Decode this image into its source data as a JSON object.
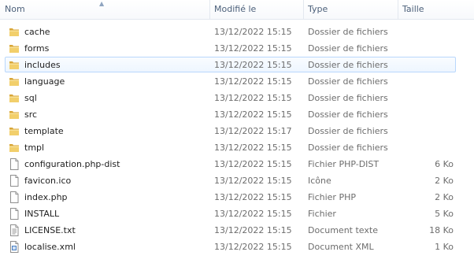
{
  "columns": {
    "name": "Nom",
    "modified": "Modifié le",
    "type": "Type",
    "size": "Taille"
  },
  "files": [
    {
      "name": "cache",
      "date": "13/12/2022 15:15",
      "type": "Dossier de fichiers",
      "size": "",
      "icon": "folder-icon"
    },
    {
      "name": "forms",
      "date": "13/12/2022 15:15",
      "type": "Dossier de fichiers",
      "size": "",
      "icon": "folder-icon"
    },
    {
      "name": "includes",
      "date": "13/12/2022 15:15",
      "type": "Dossier de fichiers",
      "size": "",
      "icon": "folder-icon"
    },
    {
      "name": "language",
      "date": "13/12/2022 15:15",
      "type": "Dossier de fichiers",
      "size": "",
      "icon": "folder-icon"
    },
    {
      "name": "sql",
      "date": "13/12/2022 15:15",
      "type": "Dossier de fichiers",
      "size": "",
      "icon": "folder-icon"
    },
    {
      "name": "src",
      "date": "13/12/2022 15:15",
      "type": "Dossier de fichiers",
      "size": "",
      "icon": "folder-icon"
    },
    {
      "name": "template",
      "date": "13/12/2022 15:17",
      "type": "Dossier de fichiers",
      "size": "",
      "icon": "folder-icon"
    },
    {
      "name": "tmpl",
      "date": "13/12/2022 15:15",
      "type": "Dossier de fichiers",
      "size": "",
      "icon": "folder-icon"
    },
    {
      "name": "configuration.php-dist",
      "date": "13/12/2022 15:15",
      "type": "Fichier PHP-DIST",
      "size": "6 Ko",
      "icon": "document-icon"
    },
    {
      "name": "favicon.ico",
      "date": "13/12/2022 15:15",
      "type": "Icône",
      "size": "2 Ko",
      "icon": "document-icon"
    },
    {
      "name": "index.php",
      "date": "13/12/2022 15:15",
      "type": "Fichier PHP",
      "size": "2 Ko",
      "icon": "document-icon"
    },
    {
      "name": "INSTALL",
      "date": "13/12/2022 15:15",
      "type": "Fichier",
      "size": "5 Ko",
      "icon": "document-icon"
    },
    {
      "name": "LICENSE.txt",
      "date": "13/12/2022 15:15",
      "type": "Document texte",
      "size": "18 Ko",
      "icon": "text-document-icon"
    },
    {
      "name": "localise.xml",
      "date": "13/12/2022 15:15",
      "type": "Document XML",
      "size": "1 Ko",
      "icon": "xml-document-icon"
    }
  ],
  "hovered_row": "includes",
  "colors": {
    "header_text": "#4c607a",
    "hover_border": "#b9d7fc",
    "secondary_text": "#6d6d6d",
    "folder": "#e8c564"
  }
}
